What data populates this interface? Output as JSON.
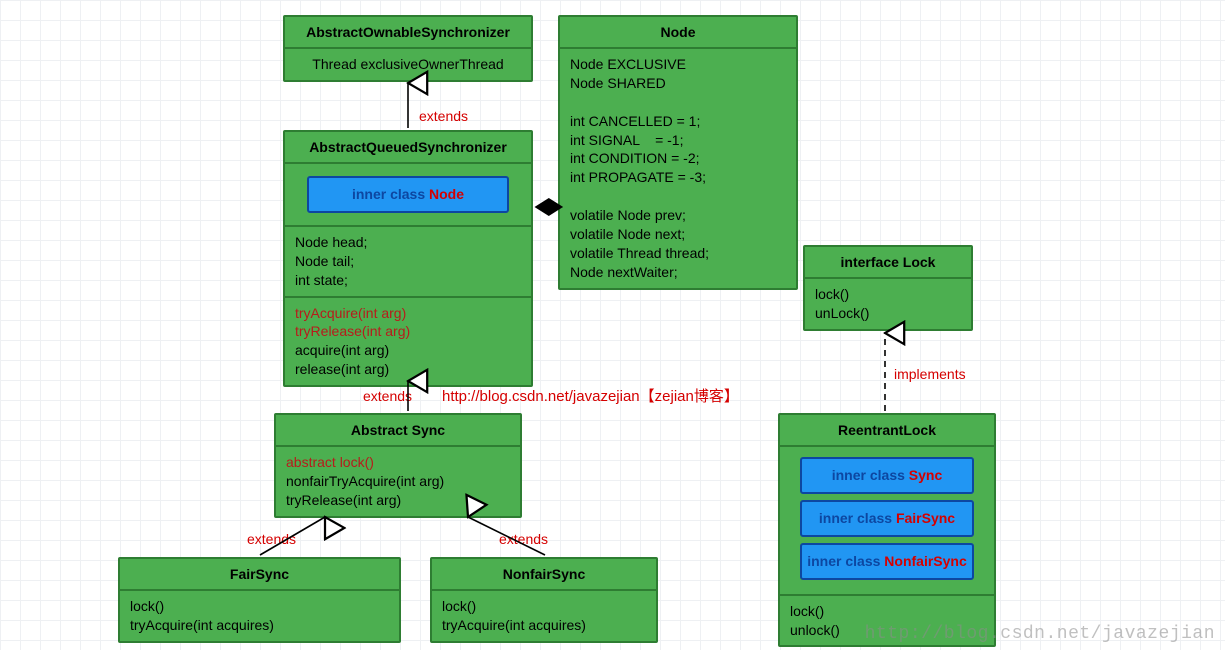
{
  "aos": {
    "title": "AbstractOwnableSynchronizer",
    "field": "Thread exclusiveOwnerThread"
  },
  "aqs": {
    "title": "AbstractQueuedSynchronizer",
    "inner_prefix": "inner class ",
    "inner_name": "Node",
    "fields": "Node head;\nNode tail;\nint state;",
    "methods_red1": "tryAcquire(int arg)",
    "methods_red2": "tryRelease(int arg)",
    "methods_plain": "acquire(int arg)\nrelease(int arg)"
  },
  "node": {
    "title": "Node",
    "body": "Node EXCLUSIVE\nNode SHARED\n\nint CANCELLED = 1;\nint SIGNAL    = -1;\nint CONDITION = -2;\nint PROPAGATE = -3;\n\nvolatile Node prev;\nvolatile Node next;\nvolatile Thread thread;\nNode nextWaiter;"
  },
  "lock": {
    "title": "interface Lock",
    "methods": "lock()\nunLock()"
  },
  "sync": {
    "title": "Abstract Sync",
    "m_red": "abstract lock()",
    "m_plain": "nonfairTryAcquire(int arg)\ntryRelease(int arg)"
  },
  "fair": {
    "title": "FairSync",
    "methods": "lock()\ntryAcquire(int acquires)"
  },
  "nonfair": {
    "title": "NonfairSync",
    "methods": "lock()\ntryAcquire(int acquires)"
  },
  "reentrant": {
    "title": "ReentrantLock",
    "inner_prefix": "inner class ",
    "inner1": "Sync",
    "inner2": "FairSync",
    "inner3": "NonfairSync",
    "methods": "lock()\nunlock()"
  },
  "labels": {
    "ext1": "extends",
    "ext2": "extends",
    "ext3": "extends",
    "ext4": "extends",
    "impl": "implements"
  },
  "blog": {
    "url": "http://blog.csdn.net/javazejian",
    "suffix": "【zejian博客】"
  },
  "watermark": "http://blog.csdn.net/javazejian"
}
